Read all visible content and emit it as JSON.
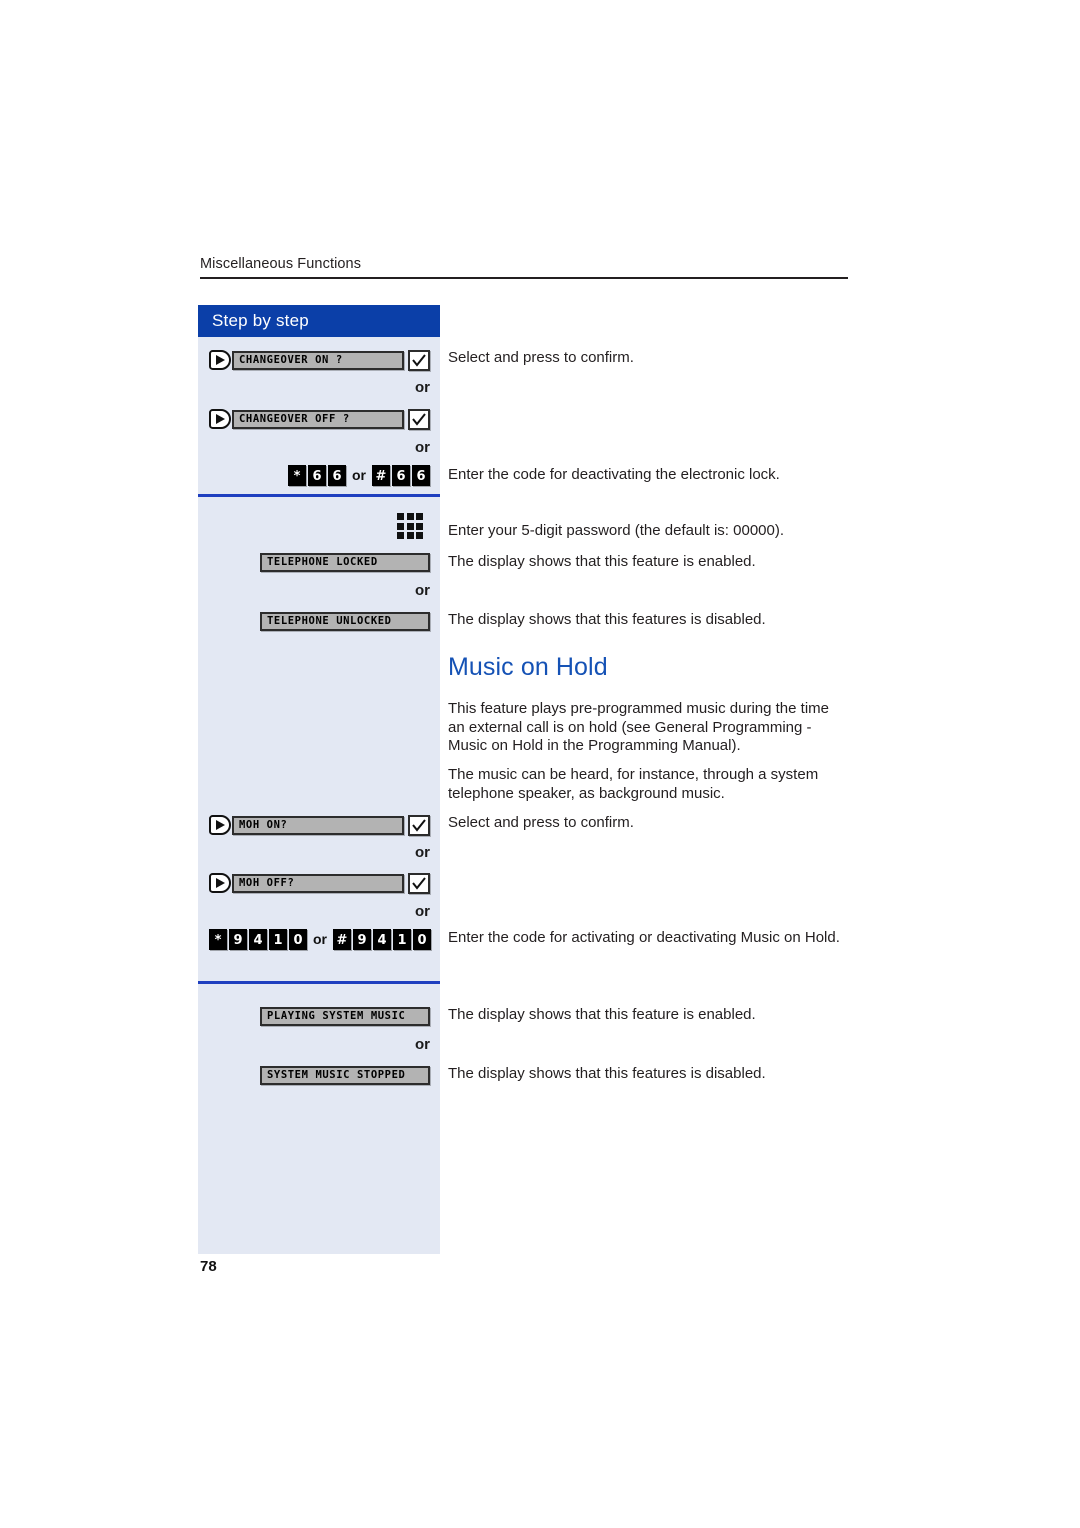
{
  "header": {
    "running_head": "Miscellaneous Functions"
  },
  "sidebar": {
    "title": "Step by step",
    "or_label": "or",
    "rows": [
      {
        "type": "menu",
        "display": "CHANGEOVER ON ?",
        "icon": "navigation-rocker-icon",
        "key": "ok-checkmark-key"
      },
      {
        "type": "menu",
        "display": "CHANGEOVER OFF ?",
        "icon": "navigation-rocker-icon",
        "key": "ok-checkmark-key"
      },
      {
        "type": "code",
        "keys": [
          "*",
          "6",
          "6"
        ],
        "separator": "or",
        "keys2": [
          "#",
          "6",
          "6"
        ]
      },
      {
        "type": "keypad",
        "icon": "keypad-3x3-icon"
      },
      {
        "type": "display",
        "display": "TELEPHONE LOCKED"
      },
      {
        "type": "display",
        "display": "TELEPHONE UNLOCKED"
      },
      {
        "type": "menu",
        "display": "MOH ON?",
        "icon": "navigation-rocker-icon",
        "key": "ok-checkmark-key"
      },
      {
        "type": "menu",
        "display": "MOH OFF?",
        "icon": "navigation-rocker-icon",
        "key": "ok-checkmark-key"
      },
      {
        "type": "code",
        "keys": [
          "*",
          "9",
          "4",
          "1",
          "0"
        ],
        "separator": "or",
        "keys2": [
          "#",
          "9",
          "4",
          "1",
          "0"
        ]
      },
      {
        "type": "display",
        "display": "PLAYING SYSTEM MUSIC"
      },
      {
        "type": "display",
        "display": "SYSTEM MUSIC STOPPED"
      }
    ]
  },
  "content": {
    "confirm_1": "Select and press to confirm.",
    "lock_code": "Enter the code for deactivating the electronic lock.",
    "password": "Enter your 5-digit password (the default is:  00000).",
    "locked_note": "The display shows that this feature is enabled.",
    "unlocked_note": "The display shows that this features is disabled.",
    "moh_title": "Music on Hold",
    "moh_para1": "This feature plays pre-programmed music during the time an external call is on hold (see General Programming - Music on Hold in the Programming Manual).",
    "moh_para2": "The music can be heard, for instance, through a system telephone speaker, as background music.",
    "confirm_2": "Select and press to confirm.",
    "moh_code": "Enter the code for activating or deactivating Music on Hold.",
    "playing_note": "The display shows that this feature is enabled.",
    "stopped_note": "The display shows that this features is disabled."
  },
  "footer": {
    "page_number": "78"
  },
  "colors": {
    "header_blue": "#0b3fa8",
    "panel_bg": "#e3e8f3",
    "divider_blue": "#1f3fbf",
    "heading_blue": "#1552b5",
    "lcd_gray": "#b3b3b3"
  }
}
